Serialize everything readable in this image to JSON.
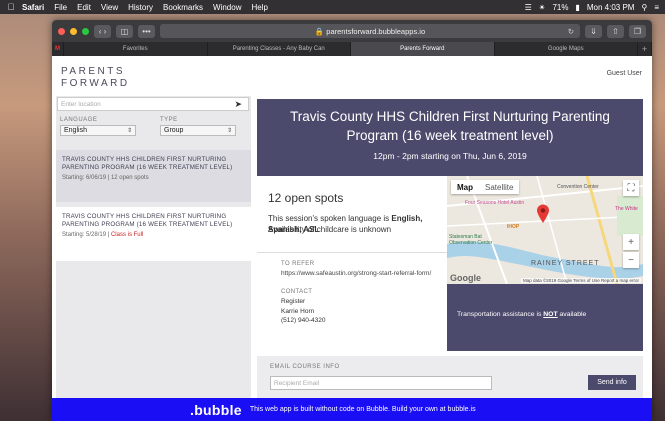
{
  "menubar": {
    "app": "Safari",
    "items": [
      "File",
      "Edit",
      "View",
      "History",
      "Bookmarks",
      "Window",
      "Help"
    ],
    "battery": "71%",
    "clock": "Mon 4:03 PM"
  },
  "browser": {
    "url": "parentsforward.bubbleapps.io",
    "tabs": [
      "Favorites",
      "Parenting Classes - Any Baby Can",
      "Parents Forward",
      "Google Maps"
    ],
    "active_tab": "Parents Forward"
  },
  "header": {
    "logo_line1": "PARENTS",
    "logo_line2": "FORWARD",
    "user": "Guest User"
  },
  "filters": {
    "location_placeholder": "Enter location",
    "language_label": "LANGUAGE",
    "language_value": "English",
    "type_label": "TYPE",
    "type_value": "Group"
  },
  "classes": [
    {
      "title": "TRAVIS COUNTY HHS CHILDREN FIRST NURTURING PARENTING PROGRAM (16 WEEK TREATMENT LEVEL)",
      "starting": "Starting: 6/06/19",
      "sep": "|",
      "status": "12 open spots"
    },
    {
      "title": "TRAVIS COUNTY HHS CHILDREN FIRST NURTURING PARENTING PROGRAM (16 WEEK TREATMENT LEVEL)",
      "starting": "Starting: 5/28/19",
      "sep": "|",
      "status": "Class is Full"
    }
  ],
  "detail": {
    "title": "Travis County HHS Children First Nurturing Parenting Program (16 week treatment level)",
    "schedule": "12pm - 2pm starting on Thu, Jun 6, 2019",
    "spots": "12 open spots",
    "language_prefix": "This session's spoken language is ",
    "language_value": "English, Spanish, ASL",
    "childcare": "Availability of childcare is unknown",
    "refer_heading": "TO REFER",
    "refer_url": "https://www.safeaustin.org/strong-start-referral-form/",
    "contact_heading": "CONTACT",
    "contact_org": "Register",
    "contact_name": "Karrie Horn",
    "contact_phone": "(512) 940-4320",
    "transport_prefix": "Transportation assistance is ",
    "transport_emph": "NOT",
    "transport_suffix": " available"
  },
  "map": {
    "tab_map": "Map",
    "tab_satellite": "Satellite",
    "labels": [
      "Four Seasons Hotel Austin",
      "IHOP",
      "Statesman Bat Observation Center",
      "RAINEY STREET",
      "Convention Center",
      "The White"
    ],
    "footer": "Map data ©2019 Google   Terms of Use   Report a map error",
    "google": "Google"
  },
  "email": {
    "heading": "EMAIL COURSE INFO",
    "placeholder": "Recipient Email",
    "button": "Send info"
  },
  "bubble": {
    "logo": ".bubble",
    "text": "This web app is built without code on Bubble. Build your own at bubble.is"
  },
  "colors": {
    "brand": "#4c4a6c",
    "bubble": "#1a0ef5",
    "full": "#cc2222"
  }
}
